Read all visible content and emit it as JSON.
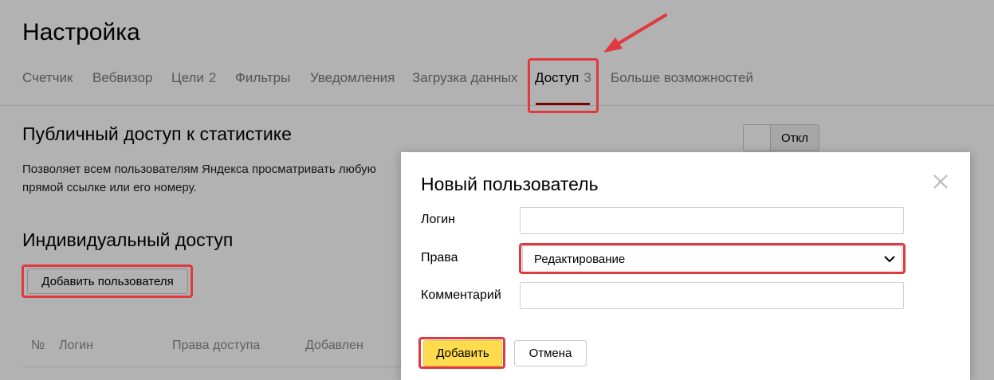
{
  "page": {
    "title": "Настройка",
    "tabs": [
      {
        "label": "Счетчик",
        "count": ""
      },
      {
        "label": "Вебвизор",
        "count": ""
      },
      {
        "label": "Цели",
        "count": "2"
      },
      {
        "label": "Фильтры",
        "count": ""
      },
      {
        "label": "Уведомления",
        "count": ""
      },
      {
        "label": "Загрузка данных",
        "count": ""
      },
      {
        "label": "Доступ",
        "count": "3"
      },
      {
        "label": "Больше возможностей",
        "count": ""
      }
    ],
    "active_tab": "Доступ"
  },
  "public_access": {
    "heading": "Публичный доступ к статистике",
    "toggle_label": "Откл",
    "description": "Позволяет всем пользователям Яндекса просматривать любую прямой ссылке или его номеру."
  },
  "individual_access": {
    "heading": "Индивидуальный доступ",
    "add_button": "Добавить пользователя",
    "table_headers": [
      "№",
      "Логин",
      "Права доступа",
      "Добавлен"
    ]
  },
  "modal": {
    "title": "Новый пользователь",
    "login_label": "Логин",
    "login_value": "",
    "rights_label": "Права",
    "rights_value": "Редактирование",
    "comment_label": "Комментарий",
    "comment_value": "",
    "add_button": "Добавить",
    "cancel_button": "Отмена"
  },
  "colors": {
    "accent_underline": "#b00000",
    "highlight": "#e0393e",
    "primary_button": "#ffdb4d"
  }
}
